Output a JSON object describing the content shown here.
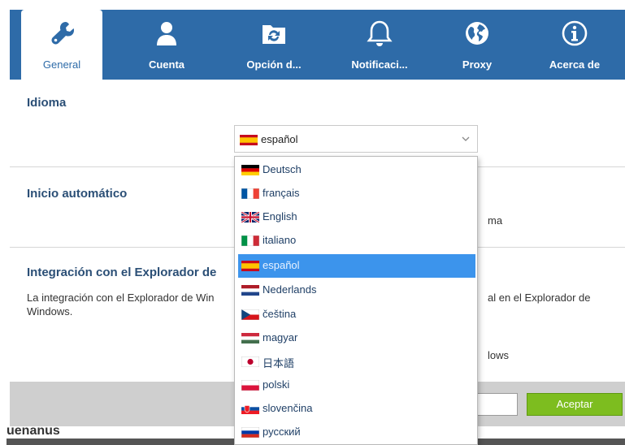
{
  "tabs": [
    {
      "label": "General",
      "icon": "wrench-icon",
      "active": true
    },
    {
      "label": "Cuenta",
      "icon": "user-icon",
      "active": false
    },
    {
      "label": "Opción d...",
      "icon": "sync-folder-icon",
      "active": false
    },
    {
      "label": "Notificaci...",
      "icon": "bell-icon",
      "active": false
    },
    {
      "label": "Proxy",
      "icon": "globe-icon",
      "active": false
    },
    {
      "label": "Acerca de",
      "icon": "info-icon",
      "active": false
    }
  ],
  "language": {
    "title": "Idioma",
    "selected": "español",
    "options": [
      {
        "label": "Deutsch",
        "flag": "de"
      },
      {
        "label": "français",
        "flag": "fr"
      },
      {
        "label": "English",
        "flag": "gb"
      },
      {
        "label": "italiano",
        "flag": "it"
      },
      {
        "label": "español",
        "flag": "es",
        "selected": true
      },
      {
        "label": "Nederlands",
        "flag": "nl"
      },
      {
        "label": "čeština",
        "flag": "cz"
      },
      {
        "label": "magyar",
        "flag": "hu"
      },
      {
        "label": "日本語",
        "flag": "jp"
      },
      {
        "label": "polski",
        "flag": "pl"
      },
      {
        "label": "slovenčina",
        "flag": "sk"
      },
      {
        "label": "русский",
        "flag": "ru"
      }
    ]
  },
  "autostart": {
    "title": "Inicio automático",
    "partial_text": "ma"
  },
  "explorer": {
    "title": "Integración con el Explorador de",
    "desc_line1_left": "La integración con el Explorador de Win",
    "desc_line1_right": "al en el Explorador de",
    "desc_line2": "Windows.",
    "partial_text": "lows"
  },
  "footer": {
    "ok_label": "Aceptar"
  },
  "background_text": "uenanus",
  "colors": {
    "accent": "#2e6ba8",
    "selected_option": "#3c94ec",
    "ok_button": "#7dbd1f"
  }
}
